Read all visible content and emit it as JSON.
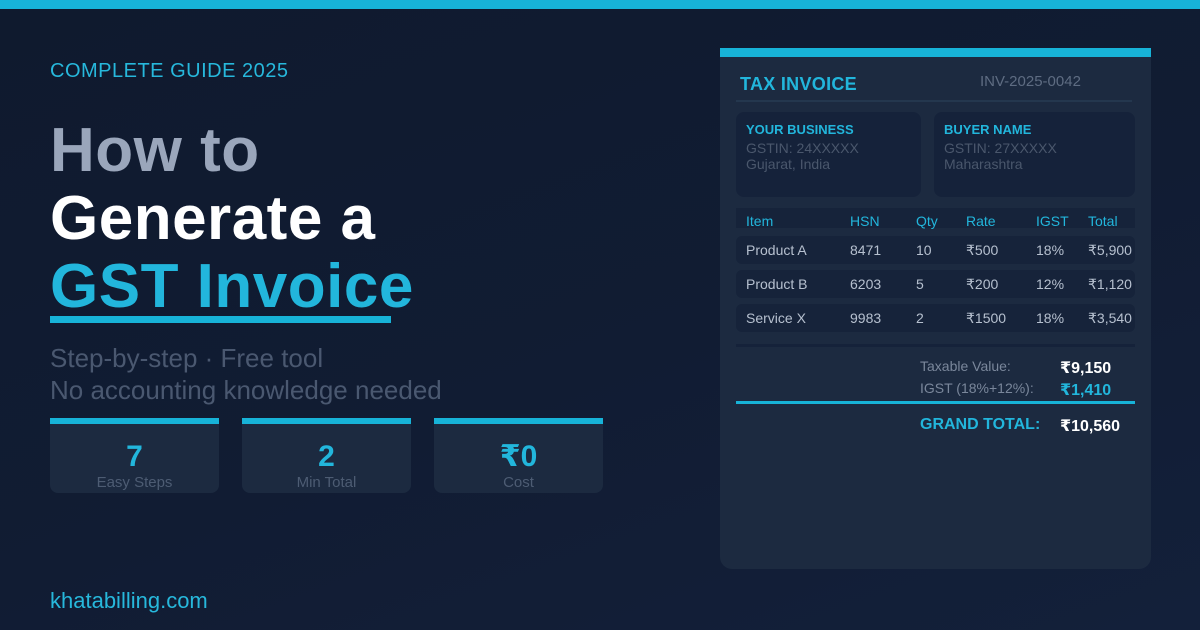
{
  "hero": {
    "eyebrow": "COMPLETE GUIDE  2025",
    "title_line1": "How to",
    "title_line2": "Generate a",
    "title_line3": "GST Invoice",
    "subtitle_line1": "Step-by-step · Free tool",
    "subtitle_line2": "No accounting knowledge needed"
  },
  "stats": [
    {
      "value": "7",
      "label": "Easy Steps"
    },
    {
      "value": "2",
      "label": "Min Total"
    },
    {
      "value": "₹0",
      "label": "Cost"
    }
  ],
  "footer": {
    "url": "khatabilling.com"
  },
  "invoice": {
    "title": "TAX INVOICE",
    "number": "INV-2025-0042",
    "seller": {
      "title": "YOUR BUSINESS",
      "gstin": "GSTIN: 24XXXXX",
      "location": "Gujarat, India"
    },
    "buyer": {
      "title": "BUYER NAME",
      "gstin": "GSTIN: 27XXXXX",
      "location": "Maharashtra"
    },
    "columns": [
      "Item",
      "HSN",
      "Qty",
      "Rate",
      "IGST",
      "Total"
    ],
    "rows": [
      [
        "Product A",
        "8471",
        "10",
        "₹500",
        "18%",
        "₹5,900"
      ],
      [
        "Product B",
        "6203",
        "5",
        "₹200",
        "12%",
        "₹1,120"
      ],
      [
        "Service X",
        "9983",
        "2",
        "₹1500",
        "18%",
        "₹3,540"
      ]
    ],
    "taxable_label": "Taxable Value:",
    "taxable_value": "₹9,150",
    "igst_label": "IGST (18%+12%):",
    "igst_value": "₹1,410",
    "grand_label": "GRAND TOTAL:",
    "grand_value": "₹10,560"
  },
  "colors": {
    "accent": "#17b3d8",
    "background": "#111c33",
    "card": "#1c2a40"
  }
}
